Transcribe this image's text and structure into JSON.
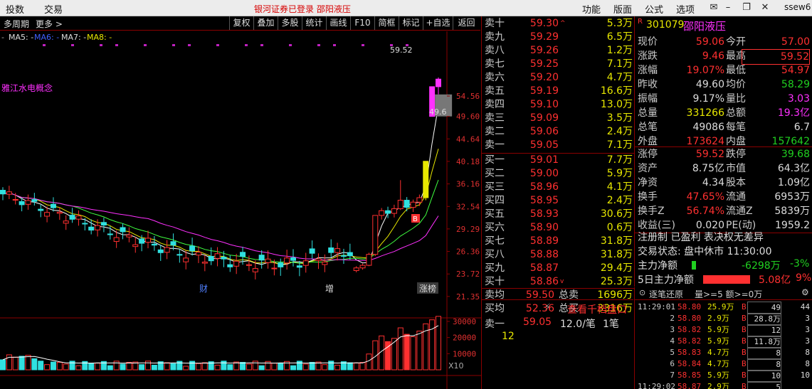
{
  "topbar": {
    "menu_left": [
      "投数",
      "交易"
    ],
    "alert": "银河证券已登录  邵阳液压",
    "menu_right": [
      "功能",
      "版面",
      "公式",
      "选项"
    ],
    "user": "ssew6"
  },
  "toolbar": {
    "left": [
      "多周期",
      "更多 >"
    ],
    "buttons": [
      "复权",
      "叠加",
      "多股",
      "统计",
      "画线",
      "F10",
      "简框",
      "标记",
      "+自选",
      "返回"
    ]
  },
  "ma_legend": [
    "MA5: -",
    "MA6: -",
    "MA7: -",
    "MA8: -"
  ],
  "chart_annotations": {
    "concept": "雅江水电概念",
    "high_label": "59.52",
    "gap_label": "49.6",
    "markers": [
      "财",
      "增",
      "涨榜"
    ],
    "scale_btn": "X10"
  },
  "chart_data": [
    {
      "type": "candlestick",
      "title": "",
      "y_ticks": [
        54.56,
        49.6,
        44.64,
        40.18,
        36.16,
        32.54,
        29.29,
        26.36,
        23.72,
        21.35
      ],
      "ohlc_recent": [
        [
          24.1,
          24.6,
          23.9,
          24.4
        ],
        [
          24.4,
          24.9,
          24.2,
          24.7
        ],
        [
          24.7,
          26.2,
          24.6,
          26.0
        ],
        [
          26.0,
          31.2,
          25.8,
          31.2
        ],
        [
          31.2,
          32.3,
          30.6,
          31.9
        ],
        [
          31.9,
          32.5,
          30.8,
          31.5
        ],
        [
          31.5,
          32.8,
          30.9,
          32.2
        ],
        [
          32.2,
          36.8,
          32.0,
          33.5
        ],
        [
          33.5,
          34.0,
          31.8,
          32.4
        ],
        [
          32.4,
          33.6,
          31.7,
          33.2
        ],
        [
          33.2,
          34.4,
          32.6,
          33.9
        ],
        [
          33.9,
          40.2,
          33.5,
          40.2
        ],
        [
          49.6,
          57.0,
          49.6,
          57.0
        ],
        [
          57.0,
          59.52,
          54.97,
          59.06
        ]
      ],
      "ma_series": [
        "MA5",
        "MA6",
        "MA7",
        "MA8"
      ]
    },
    {
      "type": "bar",
      "title": "",
      "y_ticks": [
        30000,
        20000,
        10000
      ],
      "values_recent": [
        4200,
        4600,
        9800,
        18000,
        21000,
        17500,
        19500,
        26000,
        22000,
        20500,
        24000,
        28500,
        31000,
        33126
      ]
    }
  ],
  "book": {
    "sell": [
      [
        "卖十",
        "59.30",
        "^",
        "5.3万"
      ],
      [
        "卖九",
        "59.29",
        "",
        "6.5万"
      ],
      [
        "卖八",
        "59.26",
        "",
        "1.2万"
      ],
      [
        "卖七",
        "59.25",
        "",
        "7.1万"
      ],
      [
        "卖六",
        "59.20",
        "",
        "4.7万"
      ],
      [
        "卖五",
        "59.19",
        "",
        "16.6万"
      ],
      [
        "卖四",
        "59.10",
        "",
        "13.0万"
      ],
      [
        "卖三",
        "59.09",
        "",
        "3.5万"
      ],
      [
        "卖二",
        "59.06",
        "",
        "2.4万"
      ],
      [
        "卖一",
        "59.05",
        "",
        "7.1万"
      ]
    ],
    "buy": [
      [
        "买一",
        "59.01",
        "",
        "7.7万"
      ],
      [
        "买二",
        "59.00",
        "",
        "5.9万"
      ],
      [
        "买三",
        "58.96",
        "",
        "4.1万"
      ],
      [
        "买四",
        "58.95",
        "",
        "2.4万"
      ],
      [
        "买五",
        "58.93",
        "",
        "30.6万"
      ],
      [
        "买六",
        "58.90",
        "",
        "0.6万"
      ],
      [
        "买七",
        "58.89",
        "",
        "31.8万"
      ],
      [
        "买八",
        "58.88",
        "",
        "31.8万"
      ],
      [
        "买九",
        "58.87",
        "",
        "29.4万"
      ],
      [
        "买十",
        "58.86",
        "v",
        "25.3万"
      ]
    ],
    "avg_sell": {
      "label": "卖均",
      "price": "59.50",
      "label2": "总卖",
      "vol": "1696万"
    },
    "avg_buy": {
      "label": "买均",
      "price": "52.36",
      "label2": "总买",
      "vol": "3316万"
    },
    "depth_btn": "查看千档盘口",
    "order": {
      "label": "卖一",
      "price": "59.05",
      "per": "12.0/笔",
      "count": "1笔",
      "queue": "12"
    }
  },
  "quote": {
    "code": "301079",
    "name": "邵阳液压",
    "badge": "R",
    "rows": [
      [
        "现价",
        "59.06",
        "今开",
        "57.00"
      ],
      [
        "涨跌",
        "9.46",
        "最高",
        "59.52"
      ],
      [
        "涨幅",
        "19.07%",
        "最低",
        "54.97"
      ],
      [
        "昨收",
        "49.60",
        "均价",
        "58.29"
      ],
      [
        "振幅",
        "9.17%",
        "量比",
        "3.03"
      ],
      [
        "总量",
        "331266",
        "总额",
        "19.3亿"
      ],
      [
        "总笔",
        "49086",
        "每笔",
        "6.7"
      ],
      [
        "外盘",
        "173624",
        "内盘",
        "157642"
      ]
    ],
    "rows2": [
      [
        "涨停",
        "59.52",
        "跌停",
        "39.68"
      ],
      [
        "资产",
        "8.75亿",
        "市值",
        "64.3亿"
      ],
      [
        "净资",
        "4.34",
        "股本",
        "1.09亿"
      ],
      [
        "换手",
        "47.65%",
        "流通",
        "6953万"
      ],
      [
        "换手Z",
        "56.74%",
        "流通Z",
        "5839万"
      ],
      [
        "收益(三)",
        "0.020",
        "PE(动)",
        "1959.2"
      ]
    ],
    "flags": "注册制 已盈利 表决权无差异",
    "status": "交易状态: 盘中休市 11:30:00",
    "main_net": {
      "label": "主力净额",
      "value": "-6298万",
      "pct": "-3%"
    },
    "main5": {
      "label": "5日主力净额",
      "value": "5.08亿",
      "pct": "9%"
    }
  },
  "ticks": {
    "header": [
      "逐笔还原",
      "量>=5 额>=0万"
    ],
    "rows": [
      [
        "11:29:01",
        "58.80",
        "25.9万",
        "B",
        "49",
        "44"
      ],
      [
        "2",
        "58.80",
        "2.9万",
        "B",
        "28.8万",
        "3"
      ],
      [
        "3",
        "58.82",
        "5.9万",
        "B",
        "12",
        "3"
      ],
      [
        "4",
        "58.82",
        "5.9万",
        "B",
        "11.8万",
        "3"
      ],
      [
        "5",
        "58.83",
        "4.7万",
        "B",
        "8",
        "8"
      ],
      [
        "6",
        "58.84",
        "4.7万",
        "B",
        "8",
        "8"
      ],
      [
        "7",
        "58.85",
        "5.9万",
        "B",
        "10",
        "10"
      ],
      [
        "11:29:02",
        "58.87",
        "2.9万",
        "B",
        "5",
        ""
      ]
    ]
  }
}
